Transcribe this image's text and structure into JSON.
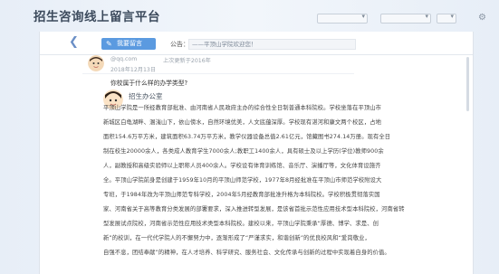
{
  "app": {
    "title": "招生咨询线上留言平台"
  },
  "selects": [
    {
      "value": ""
    },
    {
      "value": ""
    }
  ],
  "header": {
    "message_button": "我要留言",
    "notice_label": "公告：",
    "notice_text": "——平顶山学院欢迎您！"
  },
  "prev_post": {
    "email": "@qq.com",
    "meta": "上次更新于2016年",
    "date": "2018年12月13日"
  },
  "question": "你校属于什么样的办学类型?",
  "reply": {
    "author": "招生办公室",
    "lines": [
      "平顶山学院是一所经教育部批准、由河南省人民政府主办的综合性全日制普通本科院校。学校坐落在平顶山市",
      "新城区白龟湖畔、溷滍山下，依山傍水，自然环境优美，人文底蕴深厚。学校现有湛河和康文两个校区，占地",
      "面积154.6万平方米，建筑面积63.74万平方米，教学仪器设备总值2.61亿元，馆藏图书274.14万册。现有全日",
      "制在校生20000余人，各类成人教育学生7000余人;教职工1400余人，具有硕士及以上学历(学位)教师900余",
      "人，副教授和高级实验师以上职称人员400余人。学校设有体育训练馆、音乐厅、演播厅等，文化体育设施齐",
      "全。平顶山学院前身是创建于1959年10月的平顶山师范学校，1977年8月经批准在平顶山市师范学校附设大",
      "专班，于1984年改为平顶山师范专科学校，2004年5月经教育部批准升格为本科院校。学校积极贯彻落实国",
      "家、河南省关于高等教育分类发展的部署要求，深入推进转型发展，是该省首批示范性应用技术型本科院校，河南省转",
      "型发展试点院校，河南省示范性应用技术类型本科院校。建校以来，平顶山学院秉承“厚德、博学、求是、创",
      "新”的校训，在一代代学院人的不懈努力中，逐渐形成了“严谨求实，和谐创新”的优良校风和“爱岗敬业，",
      "自强不息，团结奉献”的精神，在人才培养、科学研究、服务社会、文化传承与创新的过程中实现着自身的价值。"
    ]
  }
}
